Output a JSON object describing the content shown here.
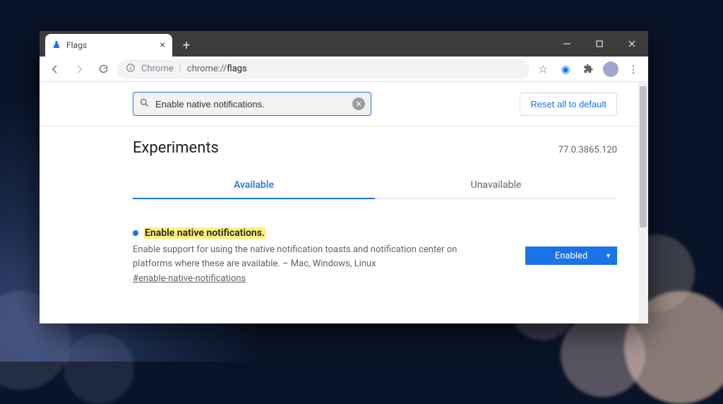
{
  "tab": {
    "title": "Flags"
  },
  "omnibox": {
    "scheme": "Chrome",
    "path_prefix": "chrome://",
    "path_bold": "flags"
  },
  "search": {
    "value": "Enable native notifications."
  },
  "reset_label": "Reset all to default",
  "page_title": "Experiments",
  "version": "77.0.3865.120",
  "tabs": {
    "available": "Available",
    "unavailable": "Unavailable"
  },
  "flag": {
    "title": "Enable native notifications.",
    "description": "Enable support for using the native notification toasts and notification center on platforms where these are available. – Mac, Windows, Linux",
    "hash": "#enable-native-notifications",
    "selected": "Enabled"
  }
}
